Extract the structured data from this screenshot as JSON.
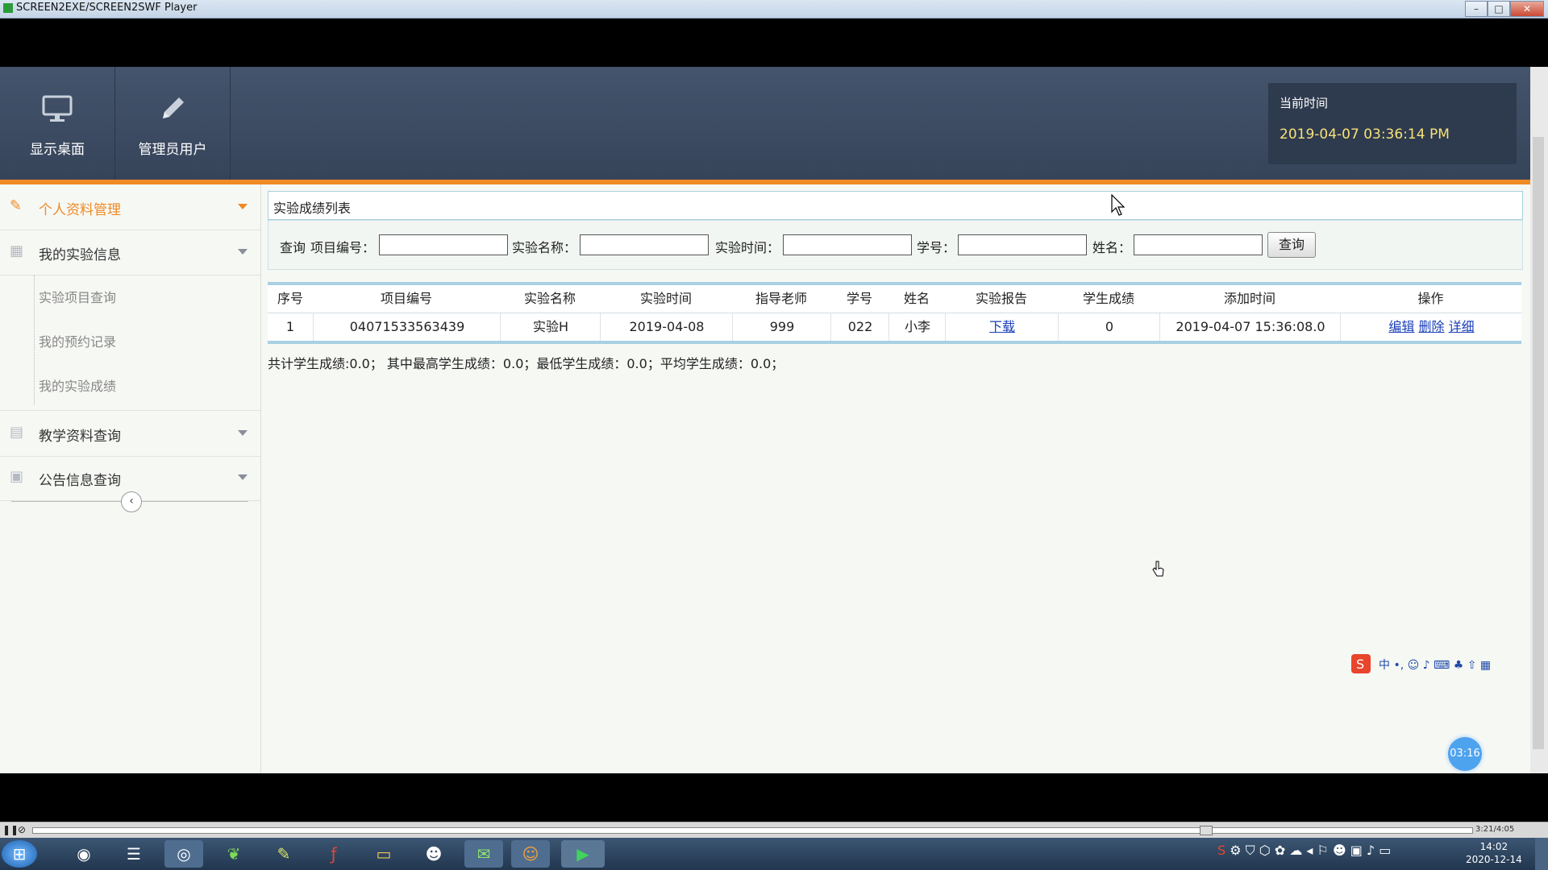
{
  "window": {
    "title": "SCREEN2EXE/SCREEN2SWF Player"
  },
  "topnav": {
    "items": [
      {
        "label": "显示桌面",
        "icon": "monitor-icon"
      },
      {
        "label": "管理员用户",
        "icon": "pencil-icon"
      }
    ],
    "clock": {
      "label": "当前时间",
      "value": "2019-04-07 03:36:14 PM"
    }
  },
  "sidebar": {
    "items": [
      {
        "label": "个人资料管理",
        "icon": "pencil-icon",
        "active": true
      },
      {
        "label": "我的实验信息",
        "icon": "grid-icon"
      },
      {
        "label": "教学资料查询",
        "icon": "layout-icon"
      },
      {
        "label": "公告信息查询",
        "icon": "calendar-icon"
      }
    ],
    "subitems": [
      "实验项目查询",
      "我的预约记录",
      "我的实验成绩"
    ]
  },
  "panel": {
    "title": "实验成绩列表"
  },
  "search": {
    "prefix": "查询",
    "fields": [
      "项目编号：",
      "实验名称：",
      "实验时间：",
      "学号：",
      "姓名："
    ],
    "button": "查询"
  },
  "table": {
    "headers": [
      "序号",
      "项目编号",
      "实验名称",
      "实验时间",
      "指导老师",
      "学号",
      "姓名",
      "实验报告",
      "学生成绩",
      "添加时间",
      "操作"
    ],
    "rows": [
      {
        "cells": [
          "1",
          "04071533563439",
          "实验H",
          "2019-04-08",
          "999",
          "022",
          "小李",
          "下载",
          "0",
          "2019-04-07 15:36:08.0"
        ],
        "actions": [
          "编辑",
          "删除",
          "详细"
        ]
      }
    ]
  },
  "summary": "共计学生成绩:0.0； 其中最高学生成绩：0.0；最低学生成绩：0.0；平均学生成绩：0.0；",
  "overlay": {
    "timer": "03:16"
  },
  "player": {
    "time": "3:21/4:05"
  },
  "taskbar": {
    "clock_time": "14:02",
    "clock_date": "2020-12-14"
  },
  "colors": {
    "accent": "#f08a24",
    "nav": "#3d4b61",
    "link": "#1a3fb8"
  }
}
